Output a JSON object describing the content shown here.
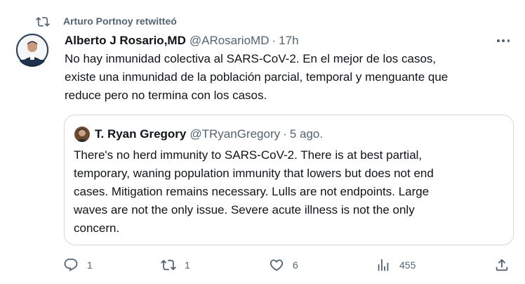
{
  "retweet": {
    "label": "Arturo Portnoy retwitteó",
    "icon": "retweet-icon"
  },
  "tweet": {
    "author_name": "Alberto J Rosario,MD",
    "handle": "@ARosarioMD",
    "separator": "·",
    "time": "17h",
    "avatar_icon": "avatar-image",
    "text": "No hay inmunidad colectiva al SARS-CoV-2. En el mejor de los casos,\nexiste una inmunidad de la población parcial, temporal y menguante que\nreduce pero no termina con los casos."
  },
  "quote": {
    "author_name": "T. Ryan Gregory",
    "handle": "@TRyanGregory",
    "separator": "·",
    "time": "5 ago.",
    "avatar_icon": "avatar-image",
    "text": "There's no herd immunity to SARS-CoV-2. There is at best partial,\ntemporary, waning population immunity that lowers but does not end\ncases. Mitigation remains necessary. Lulls are not endpoints. Large\nwaves are not the only issue. Severe acute illness is not the only\nconcern."
  },
  "actions": {
    "reply_count": "1",
    "retweet_count": "1",
    "like_count": "6",
    "view_count": "455"
  },
  "colors": {
    "text_primary": "#0f1419",
    "text_secondary": "#536471",
    "border": "#cfd9de"
  }
}
